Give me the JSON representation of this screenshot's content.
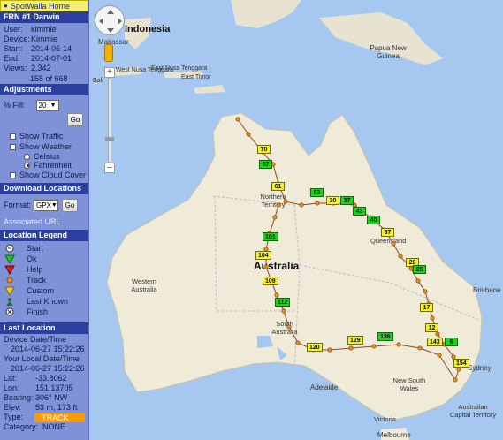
{
  "home_link": "SpotWalla Home",
  "trip": {
    "title": "FRN #1 Darwin",
    "user_label": "User:",
    "user": "kimmie",
    "device_label": "Device:",
    "device": "Kimmie",
    "start_label": "Start:",
    "start": "2014-06-14",
    "end_label": "End:",
    "end": "2014-07-01",
    "views_label": "Views:",
    "views": "2,342",
    "pager": "155 of 668"
  },
  "adjustments": {
    "title": "Adjustments",
    "fill_label": "% Fill:",
    "fill_value": "20",
    "go": "Go",
    "show_traffic": "Show Traffic",
    "show_weather": "Show Weather",
    "celsius": "Celsius",
    "fahrenheit": "Fahrenheit",
    "show_cloud": "Show Cloud Cover"
  },
  "download": {
    "title": "Download Locations",
    "format_label": "Format:",
    "format_value": "GPX",
    "go": "Go",
    "associated_url": "Associated URL"
  },
  "legend": {
    "title": "Location Legend",
    "items": [
      "Start",
      "Ok",
      "Help",
      "Track",
      "Custom",
      "Last Known",
      "Finish"
    ]
  },
  "last_location": {
    "title": "Last Location",
    "device_dt_label": "Device Date/Time",
    "device_dt": "2014-06-27 15:22:26",
    "local_dt_label": "Your Local Date/Time",
    "local_dt": "2014-06-27 15:22:26",
    "lat_label": "Lat:",
    "lat": "-33.8062",
    "lon_label": "Lon:",
    "lon": "151.13705",
    "bearing_label": "Bearing:",
    "bearing": "306° NW",
    "elev_label": "Elev:",
    "elev": "53 m, 173 ft",
    "type_label": "Type:",
    "type": "TRACK",
    "category_label": "Category:",
    "category": "NONE"
  },
  "map": {
    "labels": {
      "indonesia": "Indonesia",
      "makassar": "Makassar",
      "bali": "Bali",
      "west_nusa": "West Nusa Tenggara",
      "east_nusa": "East Nusa Tenggara",
      "east_timor": "East Timor",
      "papua": "Papua New Guinea",
      "australia": "Australia",
      "northern_territory": "Northern Territory",
      "queensland": "Queensland",
      "western_australia": "Western Australia",
      "south_australia": "South Australia",
      "nsw": "New South Wales",
      "victoria": "Victoria",
      "act": "Australian Capital Territory",
      "brisbane": "Brisbane",
      "adelaide": "Adelaide",
      "melbourne": "Melbourne",
      "sydney": "Sydney"
    },
    "flags": [
      {
        "t": "70",
        "c": "y"
      },
      {
        "t": "67",
        "c": "g"
      },
      {
        "t": "61",
        "c": "y"
      },
      {
        "t": "53",
        "c": "g"
      },
      {
        "t": "30",
        "c": "y"
      },
      {
        "t": "37",
        "c": "g"
      },
      {
        "t": "43",
        "c": "g"
      },
      {
        "t": "40",
        "c": "g"
      },
      {
        "t": "37",
        "c": "y"
      },
      {
        "t": "101",
        "c": "g"
      },
      {
        "t": "104",
        "c": "y"
      },
      {
        "t": "109",
        "c": "y"
      },
      {
        "t": "112",
        "c": "g"
      },
      {
        "t": "28",
        "c": "y"
      },
      {
        "t": "25",
        "c": "g"
      },
      {
        "t": "17",
        "c": "y"
      },
      {
        "t": "12",
        "c": "y"
      },
      {
        "t": "120",
        "c": "y"
      },
      {
        "t": "129",
        "c": "y"
      },
      {
        "t": "136",
        "c": "g"
      },
      {
        "t": "143",
        "c": "y"
      },
      {
        "t": "6",
        "c": "g"
      },
      {
        "t": "154",
        "c": "y"
      }
    ]
  }
}
